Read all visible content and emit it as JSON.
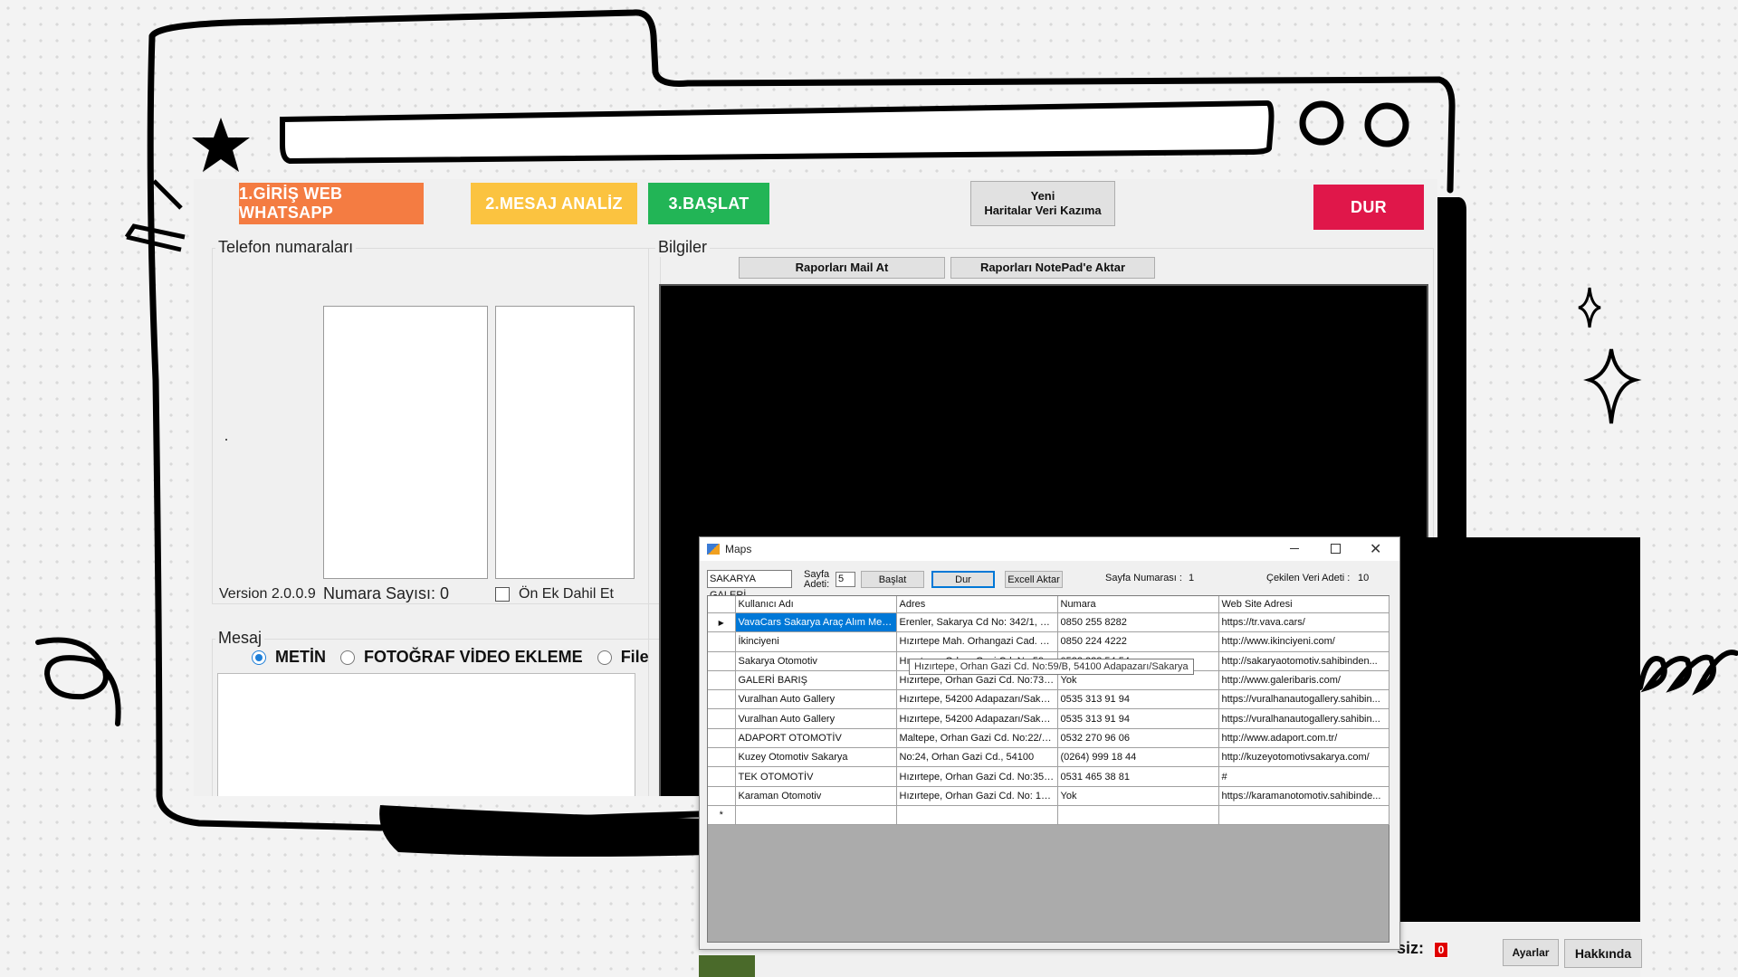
{
  "toolbar": {
    "login_label": "1.GİRİŞ WEB WHATSAPP",
    "analyze_label": "2.MESAJ ANALİZ",
    "start_label": "3.BAŞLAT",
    "scrape_line1": "Yeni",
    "scrape_line2": "Haritalar Veri Kazıma",
    "stop_label": "DUR"
  },
  "phones": {
    "group_label": "Telefon numaraları",
    "version": "Version 2.0.0.9",
    "count_label": "Numara Sayısı: 0",
    "prefix_label": "Ön Ek Dahil Et"
  },
  "message": {
    "group_label": "Mesaj",
    "opt_text": "METİN",
    "opt_photo": "FOTOĞRAF VİDEO EKLEME",
    "opt_file": "File"
  },
  "info": {
    "group_label": "Bilgiler",
    "mail_label": "Raporları Mail At",
    "notepad_label": "Raporları NotePad'e Aktar"
  },
  "maps": {
    "title": "Maps",
    "search_value": "SAKARYA GALERİ",
    "page_count_label": "Sayfa Adeti:",
    "page_count_value": "5",
    "start_label": "Başlat",
    "stop_label": "Dur",
    "excel_label": "Excell Aktar",
    "page_number_label": "Sayfa Numarası :",
    "page_number_value": "1",
    "fetched_label": "Çekilen Veri Adeti :",
    "fetched_value": "10",
    "columns": [
      "Kullanıcı Adı",
      "Adres",
      "Numara",
      "Web Site Adresi"
    ],
    "rows": [
      [
        "VavaCars Sakarya Araç Alım Merkezi",
        "Erenler, Sakarya Cd No: 342/1, 54...",
        "0850 255 8282",
        "https://tr.vava.cars/"
      ],
      [
        "İkinciyeni",
        "Hızırtepe Mah. Orhangazi Cad. Tek...",
        "0850 224 4222",
        "http://www.ikinciyeni.com/"
      ],
      [
        "Sakarya Otomotiv",
        "Hızırtepe, Orhan Gazi Cd. No:59/B...",
        "0532 222 54 54",
        "http://sakaryaotomotiv.sahibinden..."
      ],
      [
        "GALERİ BARIŞ",
        "Hızırtepe, Orhan Gazi Cd. No:73, 5...",
        "Yok",
        "http://www.galeribaris.com/"
      ],
      [
        "Vuralhan Auto Gallery",
        "Hızırtepe, 54200 Adapazarı/Sakarya",
        "0535 313 91 94",
        "https://vuralhanautogallery.sahibin..."
      ],
      [
        "Vuralhan Auto Gallery",
        "Hızırtepe, 54200 Adapazarı/Sakarya",
        "0535 313 91 94",
        "https://vuralhanautogallery.sahibin..."
      ],
      [
        "ADAPORT OTOMOTİV",
        "Maltepe, Orhan Gazi Cd. No:22/a, ...",
        "0532 270 96 06",
        "http://www.adaport.com.tr/"
      ],
      [
        "Kuzey Otomotiv Sakarya",
        "No:24, Orhan Gazi Cd., 54100",
        "(0264) 999 18 44",
        "http://kuzeyotomotivsakarya.com/"
      ],
      [
        "TEK OTOMOTİV",
        "Hızırtepe, Orhan Gazi Cd. No:35, 5...",
        "0531 465 38 81",
        "#"
      ],
      [
        "Karaman Otomotiv",
        "Hızırtepe, Orhan Gazi Cd. No: 101, ...",
        "Yok",
        "https://karamanotomotiv.sahibinde..."
      ]
    ],
    "tooltip": "Hızırtepe, Orhan Gazi Cd. No:59/B, 54100 Adapazarı/Sakarya"
  },
  "bottom": {
    "partial_label": "siz:",
    "counter_value": "0",
    "settings_label": "Ayarlar",
    "about_label": "Hakkında"
  },
  "colors": {
    "login": "#f47c42",
    "analyze": "#fbc340",
    "start": "#22b556",
    "stop": "#e0174a",
    "selection": "#0078d7"
  }
}
